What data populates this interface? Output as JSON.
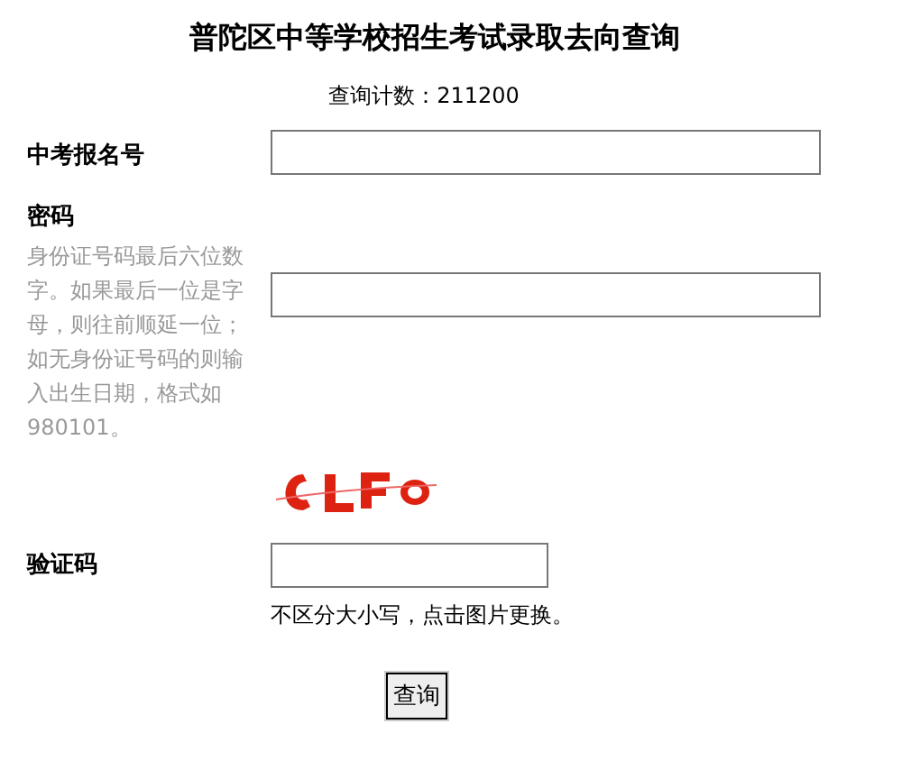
{
  "title": "普陀区中等学校招生考试录取去向查询",
  "counter": "查询计数：211200",
  "fields": [
    {
      "kind": "text",
      "label": "中考报名号"
    },
    {
      "kind": "password",
      "label": "密码",
      "hint": "身份证号码最后六位数字。如果最后一位是字母，则往前顺延一位；如无身份证号码的则输入出生日期，格式如980101。"
    },
    {
      "kind": "captcha",
      "label": "验证码",
      "hint": "不区分大小写，点击图片更换。"
    }
  ],
  "submit": "查询"
}
